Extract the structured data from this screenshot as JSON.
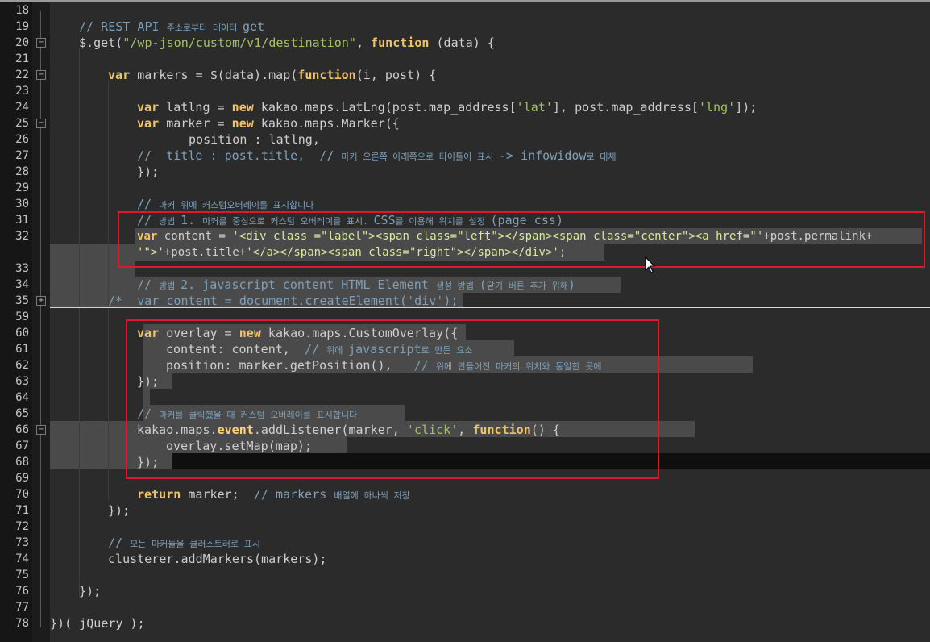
{
  "editor": {
    "lines": [
      {
        "num": "18",
        "fold": ""
      },
      {
        "num": "19",
        "fold": ""
      },
      {
        "num": "20",
        "fold": "−"
      },
      {
        "num": "21",
        "fold": ""
      },
      {
        "num": "22",
        "fold": "−"
      },
      {
        "num": "23",
        "fold": ""
      },
      {
        "num": "24",
        "fold": ""
      },
      {
        "num": "25",
        "fold": "−"
      },
      {
        "num": "26",
        "fold": ""
      },
      {
        "num": "27",
        "fold": ""
      },
      {
        "num": "28",
        "fold": ""
      },
      {
        "num": "29",
        "fold": ""
      },
      {
        "num": "30",
        "fold": ""
      },
      {
        "num": "31",
        "fold": ""
      },
      {
        "num": "32",
        "fold": ""
      },
      {
        "num": "",
        "fold": ""
      },
      {
        "num": "33",
        "fold": ""
      },
      {
        "num": "34",
        "fold": ""
      },
      {
        "num": "35",
        "fold": "+"
      },
      {
        "num": "59",
        "fold": ""
      },
      {
        "num": "60",
        "fold": ""
      },
      {
        "num": "61",
        "fold": ""
      },
      {
        "num": "62",
        "fold": ""
      },
      {
        "num": "63",
        "fold": ""
      },
      {
        "num": "64",
        "fold": ""
      },
      {
        "num": "65",
        "fold": ""
      },
      {
        "num": "66",
        "fold": "−"
      },
      {
        "num": "67",
        "fold": ""
      },
      {
        "num": "68",
        "fold": ""
      },
      {
        "num": "69",
        "fold": ""
      },
      {
        "num": "70",
        "fold": ""
      },
      {
        "num": "71",
        "fold": ""
      },
      {
        "num": "72",
        "fold": ""
      },
      {
        "num": "73",
        "fold": ""
      },
      {
        "num": "74",
        "fold": ""
      },
      {
        "num": "75",
        "fold": ""
      },
      {
        "num": "76",
        "fold": ""
      },
      {
        "num": "77",
        "fold": ""
      },
      {
        "num": "78",
        "fold": ""
      }
    ],
    "code": {
      "l19_cm": "// REST API ",
      "l19_cmk": "주소로부터 데이터 ",
      "l19_cm2": "get",
      "l20_a": "$.get(",
      "l20_str": "\"/wp-json/custom/v1/destination\"",
      "l20_b": ", ",
      "l20_kw": "function",
      "l20_c": " (data) {",
      "l22_kw": "var",
      "l22_a": " markers = $(data).map(",
      "l22_kw2": "function",
      "l22_b": "(i, post) {",
      "l24_kw": "var",
      "l24_a": " latlng = ",
      "l24_kw2": "new",
      "l24_b": " kakao.maps.LatLng(post.map_address[",
      "l24_s1": "'lat'",
      "l24_c": "], post.map_address[",
      "l24_s2": "'lng'",
      "l24_d": "]);",
      "l25_kw": "var",
      "l25_a": " marker = ",
      "l25_kw2": "new",
      "l25_b": " kakao.maps.Marker({",
      "l26_a": "position : latlng,",
      "l27_cm": "//  title : post.title,  // ",
      "l27_cmk": "마커 오른쪽 아래쪽으로 타이틀이 표시 ",
      "l27_cm2": "-> infowidow",
      "l27_cmk2": "로 대체",
      "l28_a": "});",
      "l30_cm": "// ",
      "l30_cmk": "마커 위에 커스텀오버레이를 표시합니다",
      "l31_cm": "// ",
      "l31_cmk": "방법 ",
      "l31_cm2": "1. ",
      "l31_cmk2": "마커를 중심으로 커스텀 오버레이를 표시. ",
      "l31_cm3": "CSS",
      "l31_cmk3": "를 이용해 위치를 설정 ",
      "l31_cm4": "(page css)",
      "l32_kw": "var",
      "l32_a": " content = ",
      "l32_s1": "'<div class =\"label\"><span class=\"left\"></span><span class=\"center\"><a href=\"'",
      "l32_b": "+post.permalink+",
      "l32w_s": "'\">'",
      "l32w_a": "+post.title+",
      "l32w_s2": "'</a></span><span class=\"right\"></span></div>'",
      "l32w_b": ";",
      "l34_cm": "// ",
      "l34_cmk": "방법 ",
      "l34_cm2": "2. javascript content HTML Element ",
      "l34_cmk2": "생성 방법 ",
      "l34_cm3": "(",
      "l34_cmk3": "닫기 버튼 추가 위해",
      "l34_cm4": ")",
      "l35_cm": "/*  var content = document.createElement('div');",
      "l60_kw": "var",
      "l60_a": " overlay = ",
      "l60_kw2": "new",
      "l60_b": " kakao.maps.CustomOverlay({",
      "l61_a": "content: content,  ",
      "l61_cm": "// ",
      "l61_cmk": "위에 ",
      "l61_cm2": "javascript",
      "l61_cmk2": "로 만든 요소",
      "l62_a": "position: marker.getPosition(),   ",
      "l62_cm": "// ",
      "l62_cmk": "위에 만들어진 마커의 위치와 동일한 곳에",
      "l63_a": "});",
      "l65_cm": "// ",
      "l65_cmk": "마커를 클릭했을 때 커스텀 오버레이를 표시합니다",
      "l66_a": "kakao.maps.",
      "l66_ev": "event",
      "l66_b": ".addListener(marker, ",
      "l66_s": "'click'",
      "l66_c": ", ",
      "l66_kw": "function",
      "l66_d": "() {",
      "l67_a": "overlay.setMap(map);",
      "l68_a": "});",
      "l70_kw": "return",
      "l70_a": " marker;  ",
      "l70_cm": "// markers ",
      "l70_cmk": "배열에 하나씩 저장",
      "l71_a": "});",
      "l73_cm": "// ",
      "l73_cmk": "모든 마커들을 클러스트러로 표시",
      "l74_a": "clusterer.addMarkers(markers);",
      "l76_a": "});",
      "l78_a": "})( jQuery );"
    }
  },
  "colors": {
    "highlight_box": "#e0182e",
    "background": "#2b2b2b"
  },
  "icons": {
    "cursor": "mouse-pointer-icon",
    "fold_open": "fold-minus-icon",
    "fold_closed": "fold-plus-icon"
  }
}
